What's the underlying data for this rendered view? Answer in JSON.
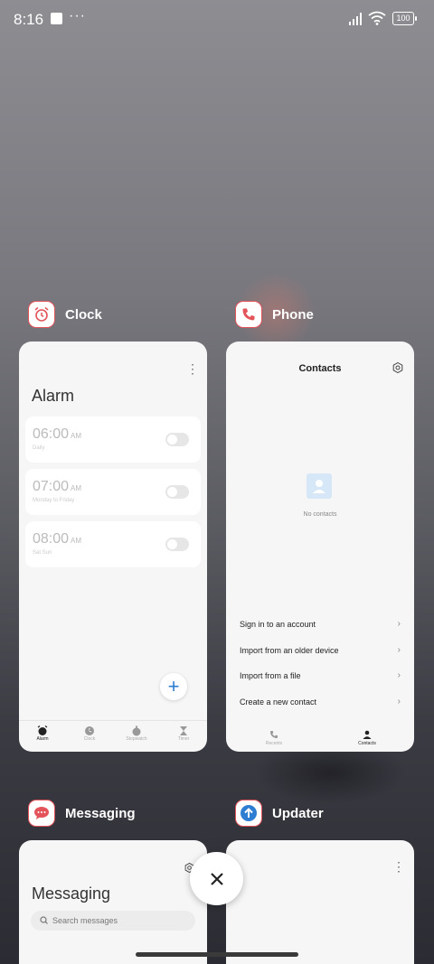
{
  "status_bar": {
    "time": "8:16",
    "more": "···",
    "battery": "100"
  },
  "apps": {
    "clock": {
      "name": "Clock",
      "title": "Alarm",
      "alarms": [
        {
          "time": "06:00",
          "ampm": "AM",
          "repeat": "Daily"
        },
        {
          "time": "07:00",
          "ampm": "AM",
          "repeat": "Monday to Friday"
        },
        {
          "time": "08:00",
          "ampm": "AM",
          "repeat": "Sat Sun"
        }
      ],
      "tabs": [
        "Alarm",
        "Clock",
        "Stopwatch",
        "Timer"
      ]
    },
    "phone": {
      "name": "Phone",
      "title": "Contacts",
      "empty_text": "No contacts",
      "actions": [
        "Sign in to an account",
        "Import from an older device",
        "Import from a file",
        "Create a new contact"
      ],
      "tabs": [
        "Recents",
        "Contacts"
      ]
    },
    "messaging": {
      "name": "Messaging",
      "title": "Messaging",
      "search_placeholder": "Search messages"
    },
    "updater": {
      "name": "Updater"
    }
  },
  "colors": {
    "accent_red": "#e2545a",
    "accent_blue": "#2d7dd2"
  }
}
